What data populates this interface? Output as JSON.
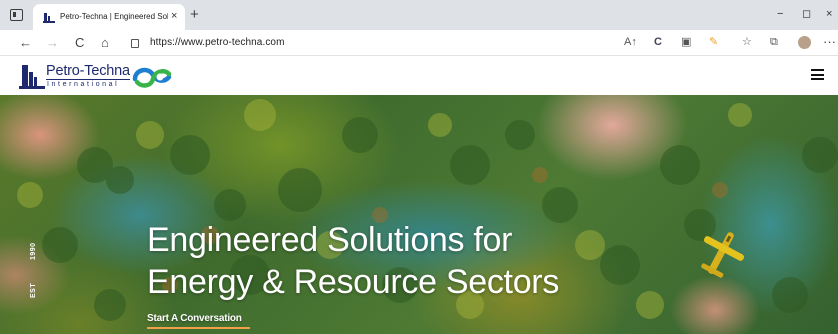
{
  "browser": {
    "tab_title": "Petro-Techna | Engineered Soluti",
    "tab_close": "×",
    "new_tab": "+",
    "url": "https://www.petro-techna.com",
    "window_controls": {
      "minimize": "−",
      "maximize": "◻",
      "close": "×"
    },
    "nav": {
      "back": "←",
      "forward": "→",
      "reload": "C",
      "home": "⌂"
    },
    "toolbar_icons": [
      "read-aloud-icon",
      "extension-c-icon",
      "screenshot-icon",
      "pencil-extension-icon",
      "favorites-icon",
      "collections-icon",
      "profile-avatar",
      "more-icon"
    ],
    "more": "···"
  },
  "site": {
    "brand_name": "Petro-Techna",
    "brand_sub": "International",
    "brand_colors": {
      "navy": "#1f2a6e",
      "blue": "#1e7fd0",
      "green": "#38b54a"
    },
    "menu_icon": "hamburger-menu-icon"
  },
  "hero": {
    "est_label": "EST",
    "est_year": "1990",
    "headline_line1": "Engineered Solutions for",
    "headline_line2": "Energy & Resource Sectors",
    "cta_label": "Start A Conversation",
    "cta_accent": "#f0a04b"
  }
}
